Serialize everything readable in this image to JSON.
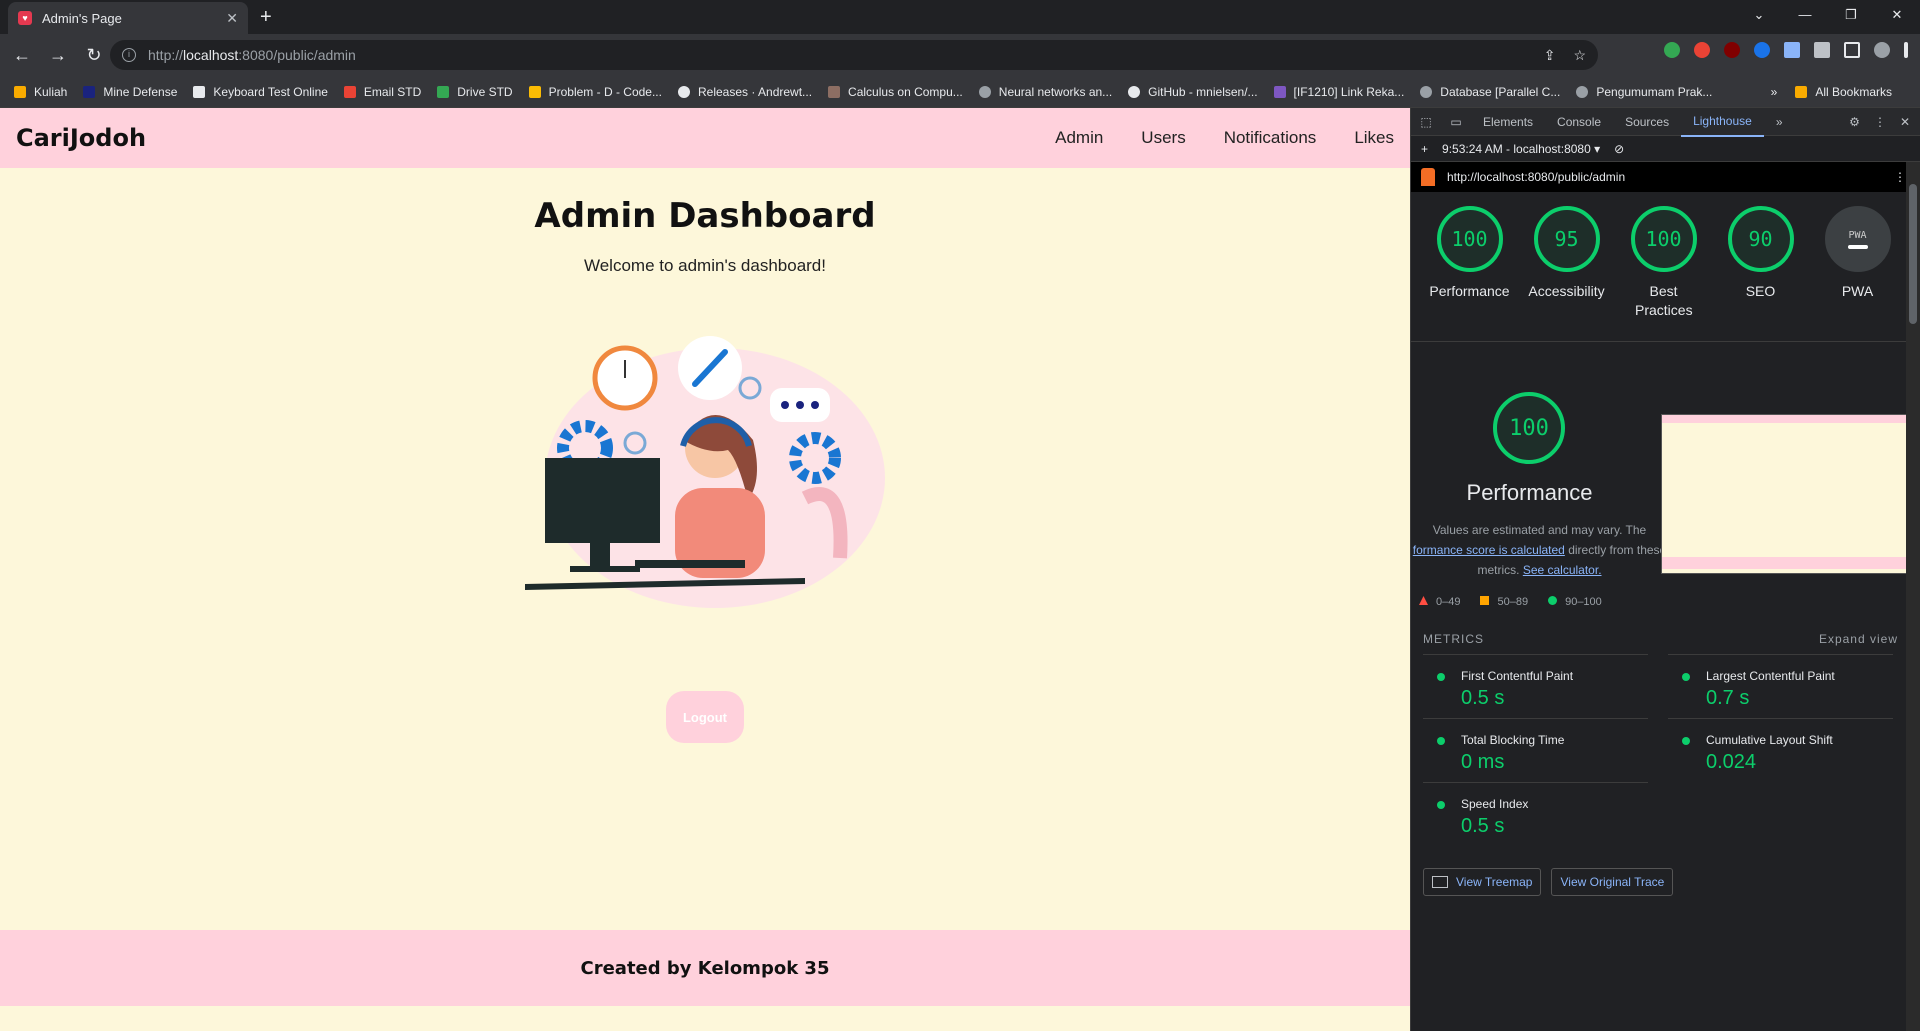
{
  "browser": {
    "tab_title": "Admin's Page",
    "url_prefix": "http://",
    "url_host": "localhost",
    "url_rest": ":8080/public/admin",
    "bookmarks": [
      "Kuliah",
      "Mine Defense",
      "Keyboard Test Online",
      "Email STD",
      "Drive STD",
      "Problem - D - Code...",
      "Releases · Andrewt...",
      "Calculus on Compu...",
      "Neural networks an...",
      "GitHub - mnielsen/...",
      "[IF1210] Link Reka...",
      "Database [Parallel C...",
      "Pengumumam Prak..."
    ],
    "all_bookmarks": "All Bookmarks"
  },
  "site": {
    "logo": "CariJodoh",
    "nav": [
      "Admin",
      "Users",
      "Notifications",
      "Likes"
    ],
    "heading": "Admin Dashboard",
    "welcome": "Welcome to admin's dashboard!",
    "logout": "Logout",
    "footer": "Created by Kelompok 35"
  },
  "devtools": {
    "tabs": [
      "Elements",
      "Console",
      "Sources",
      "Lighthouse"
    ],
    "active_tab": "Lighthouse",
    "report_time": "9:53:24 AM - localhost:8080",
    "report_url": "http://localhost:8080/public/admin",
    "scores": [
      {
        "label": "Performance",
        "value": "100"
      },
      {
        "label": "Accessibility",
        "value": "95"
      },
      {
        "label": "Best Practices",
        "value": "100"
      },
      {
        "label": "SEO",
        "value": "90"
      },
      {
        "label": "PWA",
        "value": "PWA"
      }
    ],
    "performance_title": "Performance",
    "performance_score": "100",
    "desc_1": "Values are estimated and may vary. The",
    "desc_link": "formance score is calculated",
    "desc_2": "directly from these",
    "desc_3": "metrics.",
    "calc_link": "See calculator.",
    "legend": [
      "0–49",
      "50–89",
      "90–100"
    ],
    "metrics_label": "METRICS",
    "expand": "Expand view",
    "metrics": [
      {
        "name": "First Contentful Paint",
        "value": "0.5 s"
      },
      {
        "name": "Largest Contentful Paint",
        "value": "0.7 s"
      },
      {
        "name": "Total Blocking Time",
        "value": "0 ms"
      },
      {
        "name": "Cumulative Layout Shift",
        "value": "0.024"
      },
      {
        "name": "Speed Index",
        "value": "0.5 s"
      }
    ],
    "btn_treemap": "View Treemap",
    "btn_trace": "View Original Trace"
  },
  "colors": {
    "accent_pink": "#ffd1dc",
    "page_bg": "#fdf7da",
    "lh_green": "#0cce6b"
  }
}
